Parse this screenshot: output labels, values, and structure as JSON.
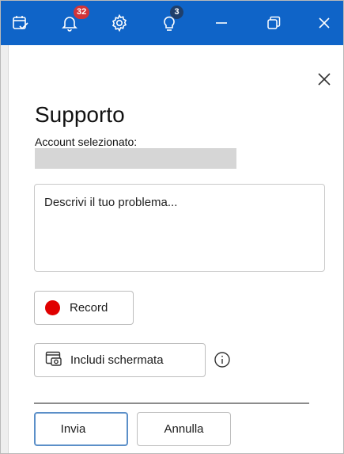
{
  "titlebar": {
    "color": "#0f64c8",
    "items": [
      {
        "icon": "task-check-icon"
      },
      {
        "icon": "bell-icon",
        "badge": "32",
        "badge_color": "#d13438"
      },
      {
        "icon": "gear-icon"
      },
      {
        "icon": "lightbulb-icon",
        "badge": "3",
        "badge_color": "#1f3f6b"
      },
      {
        "icon": "minimize-icon"
      },
      {
        "icon": "restore-icon"
      },
      {
        "icon": "close-icon"
      }
    ]
  },
  "panel": {
    "title": "Supporto",
    "account_label": "Account selezionato:",
    "description_placeholder": "Descrivi il tuo problema...",
    "record_label": "Record",
    "screenshot_label": "Includi schermata",
    "send_label": "Invia",
    "cancel_label": "Annulla"
  }
}
